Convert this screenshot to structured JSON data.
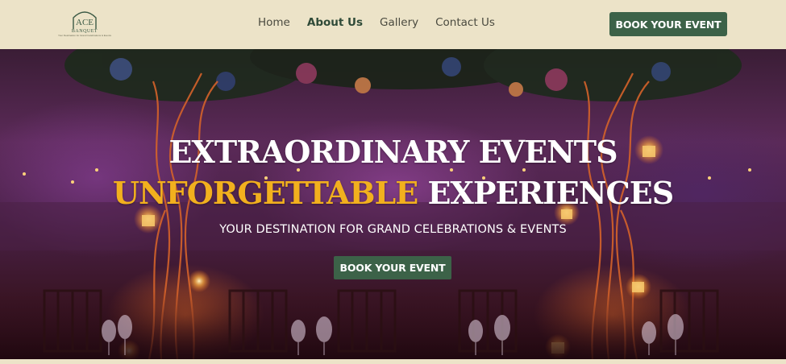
{
  "header": {
    "logo": {
      "brand": "ACE",
      "sub": "BANQUET",
      "tagline": "Your Destination for Grand Celebrations & Events"
    },
    "nav": [
      {
        "label": "Home",
        "active": false
      },
      {
        "label": "About Us",
        "active": true
      },
      {
        "label": "Gallery",
        "active": false
      },
      {
        "label": "Contact Us",
        "active": false
      }
    ],
    "cta_label": "BOOK YOUR EVENT"
  },
  "hero": {
    "title_line1": "EXTRAORDINARY EVENTS",
    "title_line2_highlight": "UNFORGETTABLE",
    "title_line2_rest": " EXPERIENCES",
    "subtitle": "YOUR DESTINATION FOR GRAND CELEBRATIONS & EVENTS",
    "cta_label": "BOOK YOUR EVENT"
  },
  "colors": {
    "header_bg": "#ece3c8",
    "accent_green": "#3c6248",
    "highlight_gold": "#f2b01e",
    "nav_text": "#4a4a3f"
  }
}
